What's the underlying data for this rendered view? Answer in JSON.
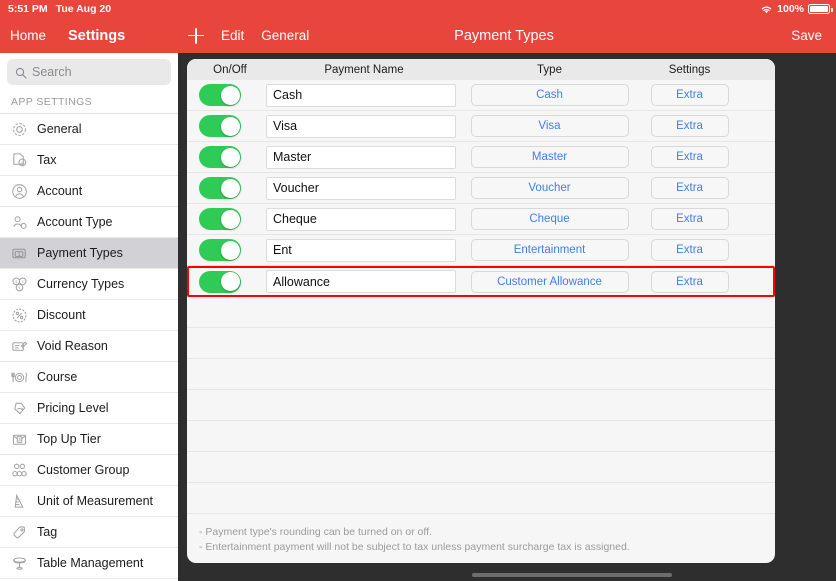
{
  "statusbar": {
    "time": "5:51 PM",
    "date": "Tue Aug 20",
    "battery_percent": "100%",
    "wifi_icon": "wifi-icon",
    "battery_icon": "battery-full-icon"
  },
  "leftnav": {
    "back_label": "Home",
    "title": "Settings"
  },
  "toolbar": {
    "add_icon": "plus-icon",
    "edit_label": "Edit",
    "general_label": "General",
    "title": "Payment Types",
    "save_label": "Save",
    "accent_color": "#e8453c"
  },
  "sidebar": {
    "search": {
      "placeholder": "Search",
      "value": "",
      "icon": "search-icon"
    },
    "section_label": "APP SETTINGS",
    "items": [
      {
        "label": "General",
        "icon": "gear-icon",
        "active": false
      },
      {
        "label": "Tax",
        "icon": "tax-document-icon",
        "active": false
      },
      {
        "label": "Account",
        "icon": "account-icon",
        "active": false
      },
      {
        "label": "Account Type",
        "icon": "account-type-icon",
        "active": false
      },
      {
        "label": "Payment Types",
        "icon": "payment-card-icon",
        "active": true
      },
      {
        "label": "Currency Types",
        "icon": "currency-icon",
        "active": false
      },
      {
        "label": "Discount",
        "icon": "percent-icon",
        "active": false
      },
      {
        "label": "Void Reason",
        "icon": "void-note-icon",
        "active": false
      },
      {
        "label": "Course",
        "icon": "cutlery-icon",
        "active": false
      },
      {
        "label": "Pricing Level",
        "icon": "price-tag-icon",
        "active": false
      },
      {
        "label": "Top Up Tier",
        "icon": "topup-envelope-icon",
        "active": false
      },
      {
        "label": "Customer Group",
        "icon": "customer-group-icon",
        "active": false
      },
      {
        "label": "Unit of Measurement",
        "icon": "ruler-icon",
        "active": false
      },
      {
        "label": "Tag",
        "icon": "tag-icon",
        "active": false
      },
      {
        "label": "Table Management",
        "icon": "table-icon",
        "active": false
      }
    ]
  },
  "table": {
    "headers": {
      "onoff": "On/Off",
      "name": "Payment Name",
      "type": "Type",
      "settings": "Settings"
    },
    "settings_button_label": "Extra",
    "empty_row_count": 7,
    "rows": [
      {
        "enabled": true,
        "name": "Cash",
        "type": "Cash",
        "settings": "Extra",
        "highlighted": false
      },
      {
        "enabled": true,
        "name": "Visa",
        "type": "Visa",
        "settings": "Extra",
        "highlighted": false
      },
      {
        "enabled": true,
        "name": "Master",
        "type": "Master",
        "settings": "Extra",
        "highlighted": false
      },
      {
        "enabled": true,
        "name": "Voucher",
        "type": "Voucher",
        "settings": "Extra",
        "highlighted": false
      },
      {
        "enabled": true,
        "name": "Cheque",
        "type": "Cheque",
        "settings": "Extra",
        "highlighted": false
      },
      {
        "enabled": true,
        "name": "Ent",
        "type": "Entertainment",
        "settings": "Extra",
        "highlighted": false
      },
      {
        "enabled": true,
        "name": "Allowance",
        "type": "Customer Allowance",
        "settings": "Extra",
        "highlighted": true
      }
    ]
  },
  "notes": {
    "line1": "- Payment type's rounding can be turned on or off.",
    "line2": "- Entertainment payment will not be subject to tax unless payment surcharge tax is assigned."
  },
  "colors": {
    "toggle_on": "#2ecc57",
    "link_blue": "#3f7fe8",
    "highlight_red": "#ff0000",
    "header_red": "#e8453c"
  }
}
